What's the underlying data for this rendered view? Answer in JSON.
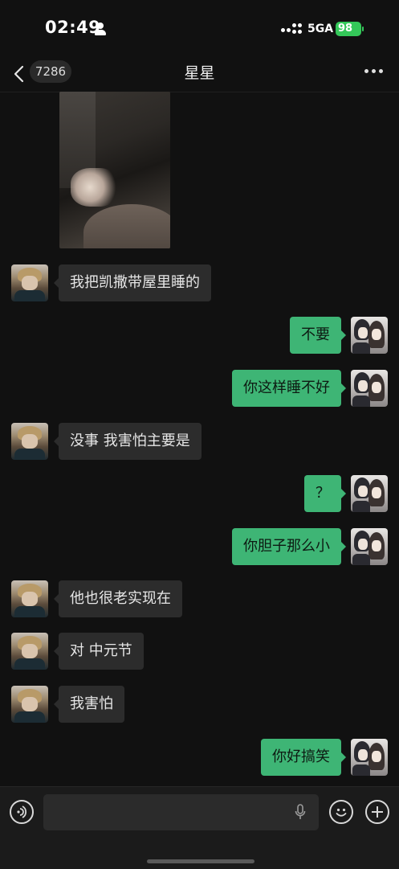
{
  "status_bar": {
    "time": "02:49",
    "network": "5GA",
    "battery": "98"
  },
  "nav": {
    "back_badge": "7286",
    "title": "星星"
  },
  "messages": [
    {
      "side": "in",
      "text": "我把凯撒带屋里睡的"
    },
    {
      "side": "out",
      "text": "不要"
    },
    {
      "side": "out",
      "text": "你这样睡不好"
    },
    {
      "side": "in",
      "text": "没事 我害怕主要是"
    },
    {
      "side": "out",
      "text": "？"
    },
    {
      "side": "out",
      "text": "你胆子那么小"
    },
    {
      "side": "in",
      "text": "他也很老实现在"
    },
    {
      "side": "in",
      "text": "对 中元节"
    },
    {
      "side": "in",
      "text": "我害怕"
    },
    {
      "side": "out",
      "text": "你好搞笑"
    }
  ],
  "colors": {
    "outgoing_bubble": "#3eb575",
    "incoming_bubble": "#2c2c2c",
    "background": "#111111",
    "battery": "#34c759"
  },
  "icons": [
    "person-icon",
    "signal-icon",
    "back-arrow-icon",
    "more-icon",
    "voice-icon",
    "microphone-icon",
    "emoji-icon",
    "plus-icon"
  ]
}
